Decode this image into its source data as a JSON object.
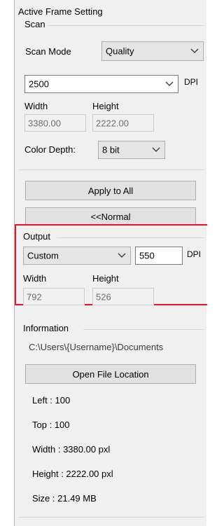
{
  "panel": {
    "title": "Active Frame Setting"
  },
  "scan": {
    "group_label": "Scan",
    "mode_label": "Scan Mode",
    "mode_value": "Quality",
    "dpi_value": "2500",
    "dpi_unit": "DPI",
    "width_label": "Width",
    "height_label": "Height",
    "width_value": "3380.00",
    "height_value": "2222.00",
    "color_depth_label": "Color Depth:",
    "color_depth_value": "8 bit"
  },
  "buttons": {
    "apply_to_all": "Apply to All",
    "normal": "<<Normal",
    "open_file_location": "Open File Location"
  },
  "output": {
    "group_label": "Output",
    "preset_value": "Custom",
    "dpi_value": "550",
    "dpi_unit": "DPI",
    "width_label": "Width",
    "height_label": "Height",
    "width_value": "792",
    "height_value": "526"
  },
  "information": {
    "group_label": "Information",
    "path": "C:\\Users\\{Username}\\Documents",
    "left": "Left : 100",
    "top": "Top : 100",
    "width": "Width : 3380.00 pxl",
    "height": "Height : 2222.00 pxl",
    "size": "Size : 21.49 MB"
  },
  "colors": {
    "highlight_border": "#e8132b",
    "panel_background": "#f0f0f0"
  }
}
